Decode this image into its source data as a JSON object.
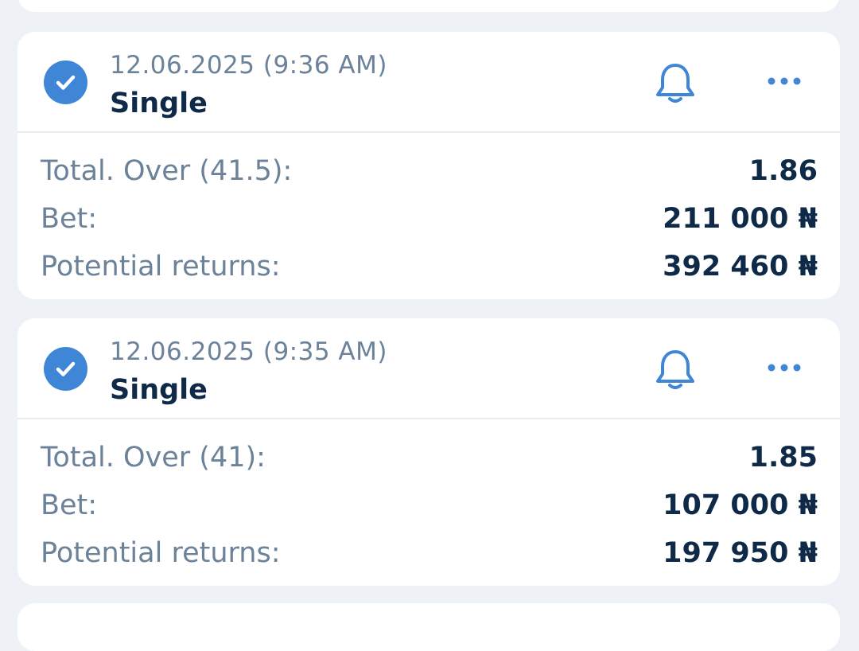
{
  "colors": {
    "background": "#eef1f6",
    "card": "#ffffff",
    "accent": "#3f86d7",
    "label": "#6b8299",
    "value": "#0f2a48"
  },
  "bets": [
    {
      "date": "12.06.2025 (9:36 AM)",
      "type": "Single",
      "status_icon": "check-circle-icon",
      "market_label": "Total. Over (41.5):",
      "odds": "1.86",
      "bet_label": "Bet:",
      "bet_amount": "211 000 ₦",
      "returns_label": "Potential returns:",
      "returns_amount": "392 460 ₦"
    },
    {
      "date": "12.06.2025 (9:35 AM)",
      "type": "Single",
      "status_icon": "check-circle-icon",
      "market_label": "Total. Over (41):",
      "odds": "1.85",
      "bet_label": "Bet:",
      "bet_amount": "107 000 ₦",
      "returns_label": "Potential returns:",
      "returns_amount": "197 950 ₦"
    }
  ]
}
